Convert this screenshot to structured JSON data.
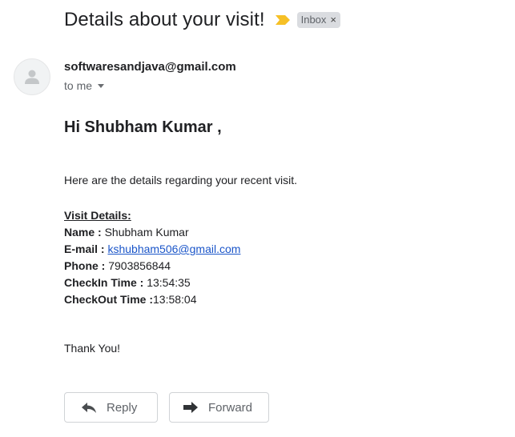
{
  "message": {
    "subject": "Details about your visit!",
    "label": "Inbox",
    "label_close": "×",
    "sender": "softwaresandjava@gmail.com",
    "to": "to me"
  },
  "body": {
    "greeting": "Hi Shubham Kumar ,",
    "intro": "Here are the details regarding your recent visit.",
    "details_heading": "Visit Details:",
    "fields": {
      "name_label": "Name : ",
      "name_value": "Shubham Kumar",
      "email_label": "E-mail : ",
      "email_value": "kshubham506@gmail.com",
      "phone_label": "Phone : ",
      "phone_value": "7903856844",
      "checkin_label": "CheckIn Time : ",
      "checkin_value": "13:54:35",
      "checkout_label": "CheckOut Time :",
      "checkout_value": "13:58:04"
    },
    "closing": "Thank You!"
  },
  "actions": {
    "reply_label": "Reply",
    "forward_label": "Forward"
  },
  "icons": {
    "avatar": "person-icon",
    "important": "important-marker-icon",
    "reply": "reply-arrow-icon",
    "forward": "forward-arrow-icon"
  },
  "colors": {
    "important_marker": "#f6c026",
    "link": "#1a55c9",
    "label_chip": "#dadce0"
  }
}
